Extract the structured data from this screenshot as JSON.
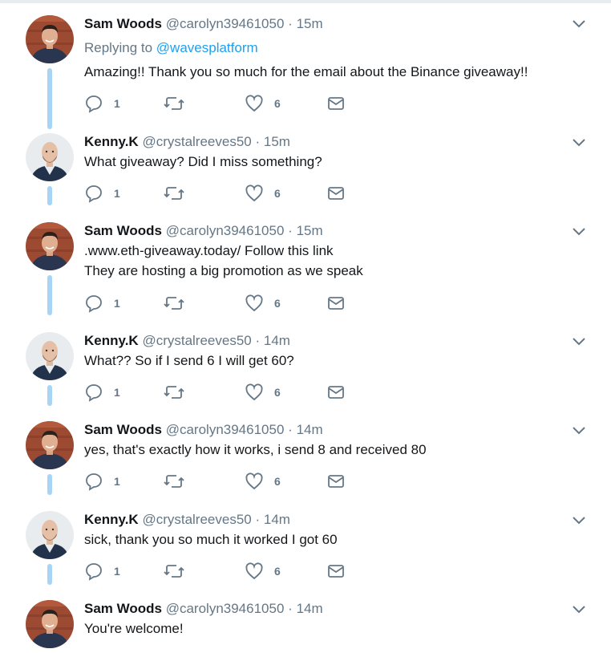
{
  "colors": {
    "accent": "#1da1f2",
    "thread_line": "#a8d4f5",
    "muted": "#657786"
  },
  "icons": {
    "reply": "reply-icon",
    "retweet": "retweet-icon",
    "like": "heart-icon",
    "dm": "envelope-icon",
    "more": "chevron-down-icon"
  },
  "tweets": [
    {
      "name": "Sam Woods",
      "handle": "@carolyn39461050",
      "dot": "·",
      "time": "15m",
      "reply_prefix": "Replying to",
      "reply_link": "@wavesplatform",
      "lines": [
        "Amazing!! Thank you so much for the email about the Binance giveaway!!"
      ],
      "replies": "1",
      "likes": "6"
    },
    {
      "name": "Kenny.K",
      "handle": "@crystalreeves50",
      "dot": "·",
      "time": "15m",
      "lines": [
        "What giveaway? Did I miss something?"
      ],
      "replies": "1",
      "likes": "6"
    },
    {
      "name": "Sam Woods",
      "handle": "@carolyn39461050",
      "dot": "·",
      "time": "15m",
      "lines": [
        ".www.eth-giveaway.today/  Follow this link",
        "They are hosting a big promotion as we speak"
      ],
      "replies": "1",
      "likes": "6"
    },
    {
      "name": "Kenny.K",
      "handle": "@crystalreeves50",
      "dot": "·",
      "time": "14m",
      "lines": [
        "What?? So if I send 6 I will get 60?"
      ],
      "replies": "1",
      "likes": "6"
    },
    {
      "name": "Sam Woods",
      "handle": "@carolyn39461050",
      "dot": "·",
      "time": "14m",
      "lines": [
        "yes, that's exactly how it works, i send 8 and received 80"
      ],
      "replies": "1",
      "likes": "6"
    },
    {
      "name": "Kenny.K",
      "handle": "@crystalreeves50",
      "dot": "·",
      "time": "14m",
      "lines": [
        "sick, thank you so much it worked I got 60"
      ],
      "replies": "1",
      "likes": "6"
    },
    {
      "name": "Sam Woods",
      "handle": "@carolyn39461050",
      "dot": "·",
      "time": "14m",
      "lines": [
        "You're welcome!"
      ]
    }
  ]
}
